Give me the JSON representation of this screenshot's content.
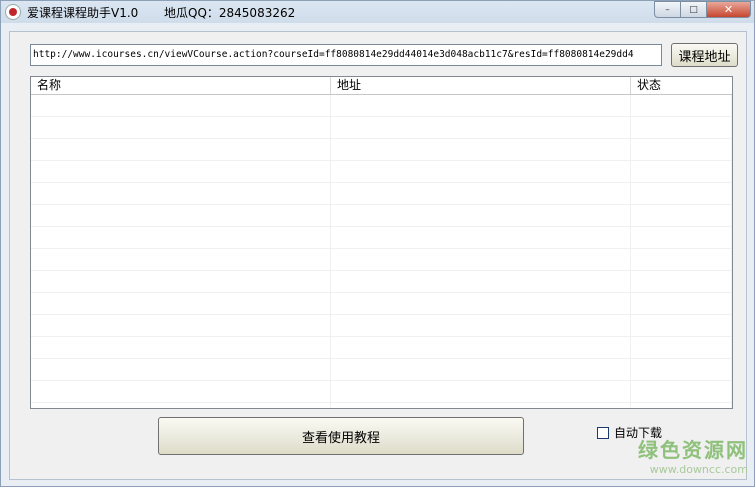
{
  "window": {
    "title": "爱课程课程助手V1.0",
    "qq": "地瓜QQ：2845083262",
    "controls": {
      "minimize": "–",
      "maximize": "□",
      "close": "✕"
    }
  },
  "url_input": {
    "value": "http://www.icourses.cn/viewVCourse.action?courseId=ff8080814e29dd44014e3d048acb11c7&resId=ff8080814e29dd4"
  },
  "buttons": {
    "course_address": "课程地址",
    "view_tutorial": "查看使用教程"
  },
  "table": {
    "columns": [
      "名称",
      "地址",
      "状态"
    ],
    "rows": []
  },
  "auto_download": {
    "label": "自动下载",
    "checked": false
  },
  "watermark": {
    "main": "绿色资源网",
    "sub": "www.downcc.com"
  },
  "colors": {
    "watermark": "#8fc17c",
    "close_button": "#c7462f"
  }
}
